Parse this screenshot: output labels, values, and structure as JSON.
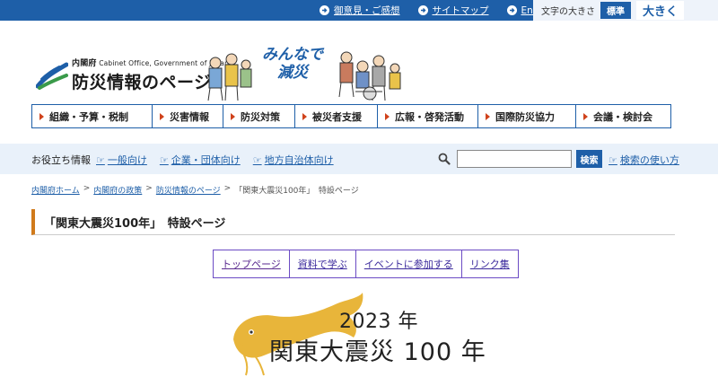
{
  "topbar": {
    "links": [
      {
        "label": "御意見・ご感想"
      },
      {
        "label": "サイトマップ"
      },
      {
        "label": "English"
      }
    ],
    "fontsize_label": "文字の大きさ",
    "fontsize_standard": "標準",
    "fontsize_large": "大きく"
  },
  "header": {
    "logo_org": "内閣府",
    "logo_org_en": "Cabinet Office, Government of Japan",
    "logo_title": "防災情報のページ",
    "slogan_line1": "みんなで",
    "slogan_line2": "減災"
  },
  "mainnav": [
    {
      "label": "組織・予算・税制"
    },
    {
      "label": "災害情報"
    },
    {
      "label": "防災対策"
    },
    {
      "label": "被災者支援"
    },
    {
      "label": "広報・啓発活動"
    },
    {
      "label": "国際防災協力"
    },
    {
      "label": "会議・検討会"
    }
  ],
  "helpbar": {
    "title": "お役立ち情報",
    "links": [
      {
        "label": "一般向け"
      },
      {
        "label": "企業・団体向け"
      },
      {
        "label": "地方自治体向け"
      }
    ],
    "search_placeholder": "",
    "search_button": "検索",
    "search_help": "検索の使い方"
  },
  "breadcrumb": {
    "items": [
      {
        "label": "内閣府ホーム"
      },
      {
        "label": "内閣府の政策"
      },
      {
        "label": "防災情報のページ"
      }
    ],
    "separator": ">",
    "current": "「関東大震災100年」　特設ページ"
  },
  "page": {
    "title": "「関東大震災100年」　特設ページ"
  },
  "subtabs": [
    {
      "label": "トップページ"
    },
    {
      "label": "資料で学ぶ"
    },
    {
      "label": "イベントに参加する"
    },
    {
      "label": "リンク集"
    }
  ],
  "banner": {
    "year": "2023 年",
    "title": "関東大震災 100 年"
  },
  "colors": {
    "primary_blue": "#1e5fa8",
    "accent_orange": "#d07a1b",
    "nav_marker_red": "#d0421b",
    "catfish_gold": "#e8b53a"
  }
}
